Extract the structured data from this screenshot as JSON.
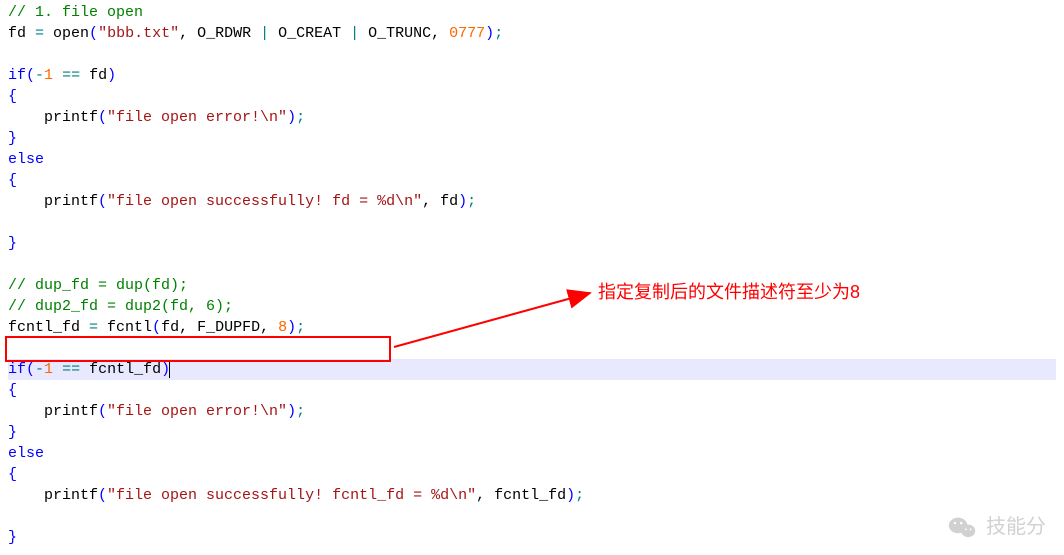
{
  "code": {
    "l1_comment": "// 1. file open",
    "l2_a": "fd ",
    "l2_eq": "=",
    "l2_b": " open",
    "l2_p1": "(",
    "l2_str": "\"bbb.txt\"",
    "l2_c": ", O_RDWR ",
    "l2_pipe1": "|",
    "l2_d": " O_CREAT ",
    "l2_pipe2": "|",
    "l2_e": " O_TRUNC, ",
    "l2_num": "0777",
    "l2_p2": ")",
    "l2_semi": ";",
    "l4_if": "if",
    "l4_p1": "(",
    "l4_neg": "-",
    "l4_num": "1",
    "l4_sp": " ",
    "l4_eqeq": "==",
    "l4_b": " fd",
    "l4_p2": ")",
    "l5_brace": "{",
    "l6_pad": "    printf",
    "l6_p1": "(",
    "l6_str": "\"file open error!\\n\"",
    "l6_p2": ")",
    "l6_semi": ";",
    "l7_brace": "}",
    "l8_else": "else",
    "l9_brace": "{",
    "l10_pad": "    printf",
    "l10_p1": "(",
    "l10_str": "\"file open successfully! fd = %d\\n\"",
    "l10_c": ", fd",
    "l10_p2": ")",
    "l10_semi": ";",
    "l12_brace": "}",
    "l14_comment": "// dup_fd = dup(fd);",
    "l15_comment": "// dup2_fd = dup2(fd, 6);",
    "l16_a": "fcntl_fd ",
    "l16_eq": "=",
    "l16_b": " fcntl",
    "l16_p1": "(",
    "l16_c": "fd, F_DUPFD, ",
    "l16_num": "8",
    "l16_p2": ")",
    "l16_semi": ";",
    "l18_if": "if",
    "l18_p1": "(",
    "l18_neg": "-",
    "l18_num": "1",
    "l18_sp": " ",
    "l18_eqeq": "==",
    "l18_b": " fcntl_fd",
    "l18_p2": ")",
    "l19_brace": "{",
    "l20_pad": "    printf",
    "l20_p1": "(",
    "l20_str": "\"file open error!\\n\"",
    "l20_p2": ")",
    "l20_semi": ";",
    "l21_brace": "}",
    "l22_else": "else",
    "l23_brace": "{",
    "l24_pad": "    printf",
    "l24_p1": "(",
    "l24_str": "\"file open successfully! fcntl_fd = %d\\n\"",
    "l24_c": ", fcntl_fd",
    "l24_p2": ")",
    "l24_semi": ";",
    "l26_brace": "}"
  },
  "callout": {
    "text": "指定复制后的文件描述符至少为8"
  },
  "watermark": {
    "text": "技能分"
  }
}
